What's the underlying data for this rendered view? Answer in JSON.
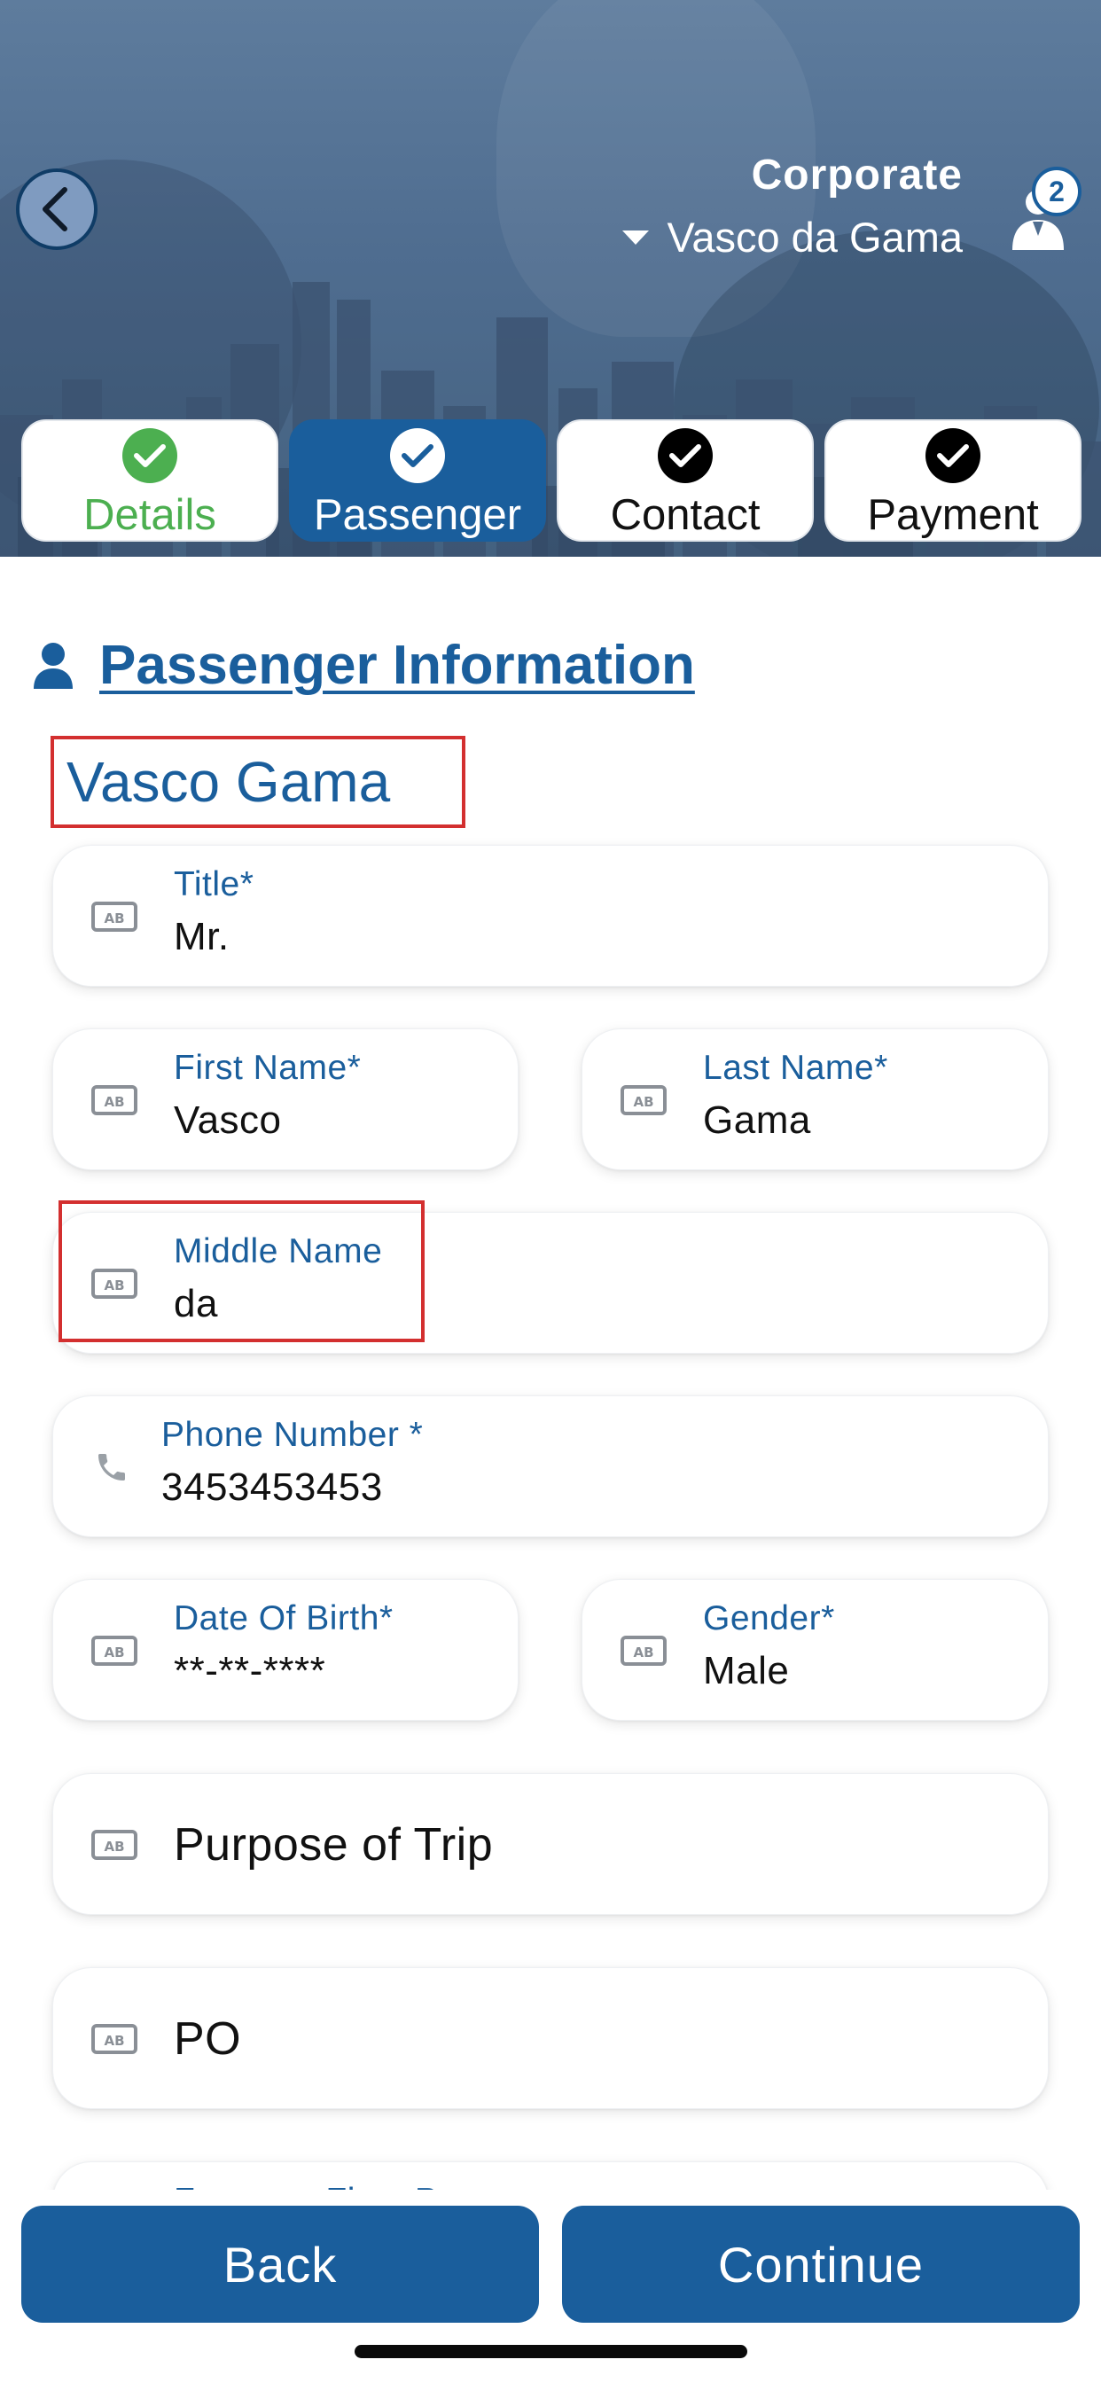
{
  "header": {
    "account_type": "Corporate",
    "selected_user": "Vasco da Gama",
    "traveler_count": "2"
  },
  "steps": [
    {
      "label": "Details",
      "state": "completed"
    },
    {
      "label": "Passenger",
      "state": "active"
    },
    {
      "label": "Contact",
      "state": "pending"
    },
    {
      "label": "Payment",
      "state": "pending"
    }
  ],
  "section": {
    "title": "Passenger Information",
    "passenger_name": "Vasco Gama"
  },
  "form": {
    "title": {
      "label": "Title*",
      "value": "Mr."
    },
    "first_name": {
      "label": "First Name*",
      "value": "Vasco"
    },
    "last_name": {
      "label": "Last Name*",
      "value": "Gama"
    },
    "middle_name": {
      "label": "Middle Name",
      "value": "da"
    },
    "phone": {
      "label": "Phone Number *",
      "value": "3453453453"
    },
    "dob": {
      "label": "Date Of Birth*",
      "value": "**-**-****"
    },
    "gender": {
      "label": "Gender*",
      "value": "Male"
    },
    "purpose": {
      "placeholder": "Purpose of Trip"
    },
    "po": {
      "placeholder": "PO"
    },
    "ffp": {
      "label": "Frequent Flyer Program"
    }
  },
  "footer": {
    "back_label": "Back",
    "continue_label": "Continue"
  },
  "colors": {
    "brand_blue": "#1a5e9c",
    "success_green": "#4caf50",
    "highlight_red": "#d32f2f"
  },
  "icons": {
    "field": "text-field-icon",
    "phone": "phone-icon",
    "person": "person-icon",
    "back": "chevron-left-icon",
    "check": "checkmark-icon",
    "travelers": "travelers-icon"
  }
}
